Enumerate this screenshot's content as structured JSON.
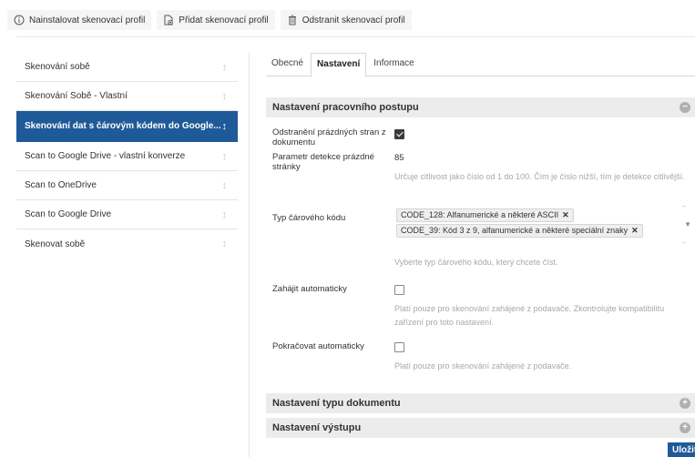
{
  "toolbar": {
    "install": {
      "label": "Nainstalovat skenovací profil",
      "icon": "info-circle-icon"
    },
    "add": {
      "label": "Přidat skenovací profil",
      "icon": "add-document-icon"
    },
    "remove": {
      "label": "Odstranit skenovací profil",
      "icon": "trash-icon"
    }
  },
  "profiles": [
    {
      "label": "Skenování sobě",
      "active": false
    },
    {
      "label": "Skenování Sobě - Vlastní",
      "active": false
    },
    {
      "label": "Skenování dat s čárovým kódem do Google...",
      "active": true
    },
    {
      "label": "Scan to Google Drive - vlastní konverze",
      "active": false
    },
    {
      "label": "Scan to OneDrive",
      "active": false
    },
    {
      "label": "Scan to Google Drive",
      "active": false
    },
    {
      "label": "Skenovat sobě",
      "active": false
    }
  ],
  "tabs": {
    "general": "Obecné",
    "settings": "Nastavení",
    "info": "Informace",
    "active": "settings"
  },
  "workflow": {
    "title": "Nastavení pracovního postupu",
    "blank_page_removal": {
      "label": "Odstranění prázdných stran z dokumentu",
      "checked": true
    },
    "blank_page_param": {
      "label": "Parametr detekce prázdné stránky",
      "value": "85",
      "hint": "Určuje citlivost jako číslo od 1 do 100. Čím je číslo nižší, tím je detekce citlivější."
    },
    "barcode_type": {
      "label": "Typ čárového kódu",
      "selected": [
        "CODE_128: Alfanumerické a některé ASCII",
        "CODE_39: Kód 3 z 9, alfanumerické a některé speciální znaky"
      ],
      "hint": "Vyberte typ čárového kódu, který chcete číst."
    },
    "auto_start": {
      "label": "Zahájit automaticky",
      "checked": false,
      "hint": "Platí pouze pro skenování zahájené z podavače. Zkontrolujte kompatibilitu zařízení pro toto nastavení."
    },
    "auto_continue": {
      "label": "Pokračovat automaticky",
      "checked": false,
      "hint": "Platí pouze pro skenování zahájené z podavače."
    }
  },
  "doc_type_section": {
    "title": "Nastavení typu dokumentu"
  },
  "output_section": {
    "title": "Nastavení výstupu"
  },
  "save_button": "Uložit",
  "colors": {
    "accent": "#1f5a98",
    "section_bg": "#ececec"
  }
}
